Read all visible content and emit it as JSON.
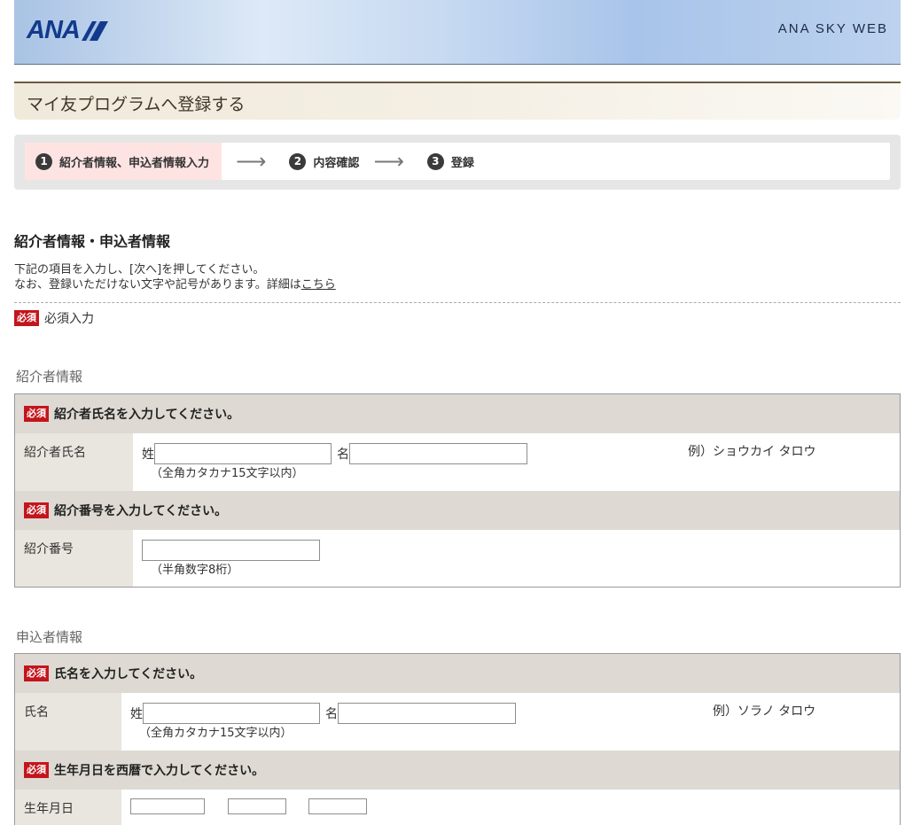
{
  "header": {
    "logo_text": "ANA",
    "site_name": "ANA SKY WEB"
  },
  "page_title": "マイ友プログラムへ登録する",
  "steps": [
    {
      "num": "1",
      "label": "紹介者情報、申込者情報入力",
      "active": true
    },
    {
      "num": "2",
      "label": "内容確認",
      "active": false
    },
    {
      "num": "3",
      "label": "登録",
      "active": false
    }
  ],
  "step_arrow": "⟶",
  "section_title": "紹介者情報・申込者情報",
  "intro": {
    "line1": "下記の項目を入力し、[次へ]を押してください。",
    "line2_prefix": "なお、登録いただけない文字や記号があります。詳細は",
    "line2_link": "こちら"
  },
  "required_badge": "必須",
  "required_legend": "必須入力",
  "referrer": {
    "group_label": "紹介者情報",
    "name_question": "紹介者氏名を入力してください。",
    "name_label": "紹介者氏名",
    "last_name_prefix": "姓",
    "first_name_prefix": "名",
    "last_name_value": "",
    "first_name_value": "",
    "name_hint": "（全角カタカナ15文字以内）",
    "name_example": "例）ショウカイ タロウ",
    "number_question": "紹介番号を入力してください。",
    "number_label": "紹介番号",
    "number_value": "",
    "number_hint": "（半角数字8桁）"
  },
  "applicant": {
    "group_label": "申込者情報",
    "name_question": "氏名を入力してください。",
    "name_label": "氏名",
    "last_name_prefix": "姓",
    "first_name_prefix": "名",
    "last_name_value": "",
    "first_name_value": "",
    "name_hint": "（全角カタカナ15文字以内）",
    "name_example": "例）ソラノ タロウ",
    "birth_question": "生年月日を西暦で入力してください。",
    "birth_label": "生年月日"
  }
}
